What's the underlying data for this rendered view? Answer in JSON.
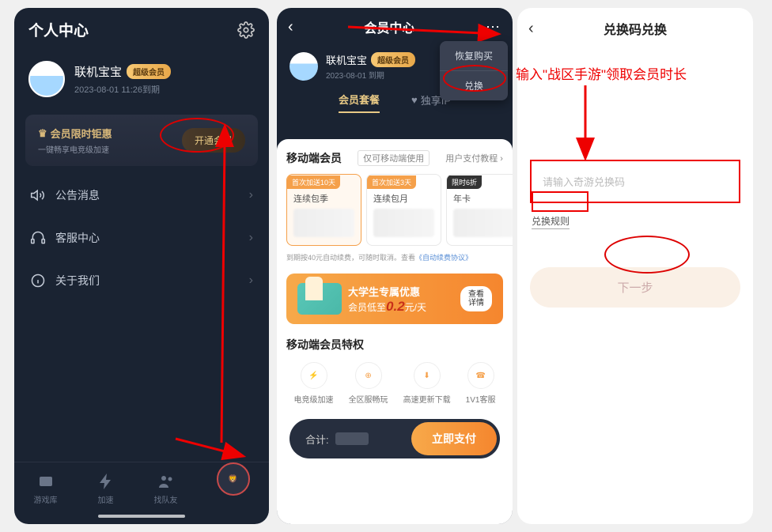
{
  "panel1": {
    "title": "个人中心",
    "user": {
      "name": "联机宝宝",
      "badge": "超级会员",
      "date": "2023-08-01 11:26到期"
    },
    "promo": {
      "title": "会员限时钜惠",
      "sub": "一键畅享电竞级加速",
      "btn": "开通会员"
    },
    "menu": [
      {
        "icon": "speaker-icon",
        "label": "公告消息"
      },
      {
        "icon": "headset-icon",
        "label": "客服中心"
      },
      {
        "icon": "info-icon",
        "label": "关于我们"
      }
    ],
    "tabs": [
      "游戏库",
      "加速",
      "找队友",
      ""
    ]
  },
  "panel2": {
    "title": "会员中心",
    "dropdown": [
      "恢复购买",
      "兑换"
    ],
    "user": {
      "name": "联机宝宝",
      "badge": "超级会员",
      "date": "2023-08-01 到期"
    },
    "tabs": [
      "会员套餐",
      "独享IP"
    ],
    "section_title": "移动端会员",
    "section_note": "仅可移动端使用",
    "payment_guide": "用户支付教程",
    "plans": [
      {
        "tag": "首次加送10天",
        "name": "连续包季"
      },
      {
        "tag": "首次加送3天",
        "name": "连续包月"
      },
      {
        "tag": "限时6折",
        "name": "年卡"
      }
    ],
    "renew_note_1": "到期按40元自动续费，可随时取消。查看",
    "renew_note_link": "《自动续费协议》",
    "student": {
      "line1": "大学生专属优惠",
      "line2a": "会员低至",
      "line2b": "0.2",
      "line2c": "元/天",
      "btn": "查看\n详情"
    },
    "perks_title": "移动端会员特权",
    "perks": [
      "电竞级加速",
      "全区服畅玩",
      "高速更新下载",
      "1V1客服"
    ],
    "pay_label": "合计:",
    "pay_btn": "立即支付"
  },
  "panel3": {
    "title": "兑换码兑换",
    "annotation": "输入\"战区手游\"领取会员时长",
    "placeholder": "请输入奇游兑换码",
    "rules": "兑换规则",
    "next": "下一步"
  }
}
